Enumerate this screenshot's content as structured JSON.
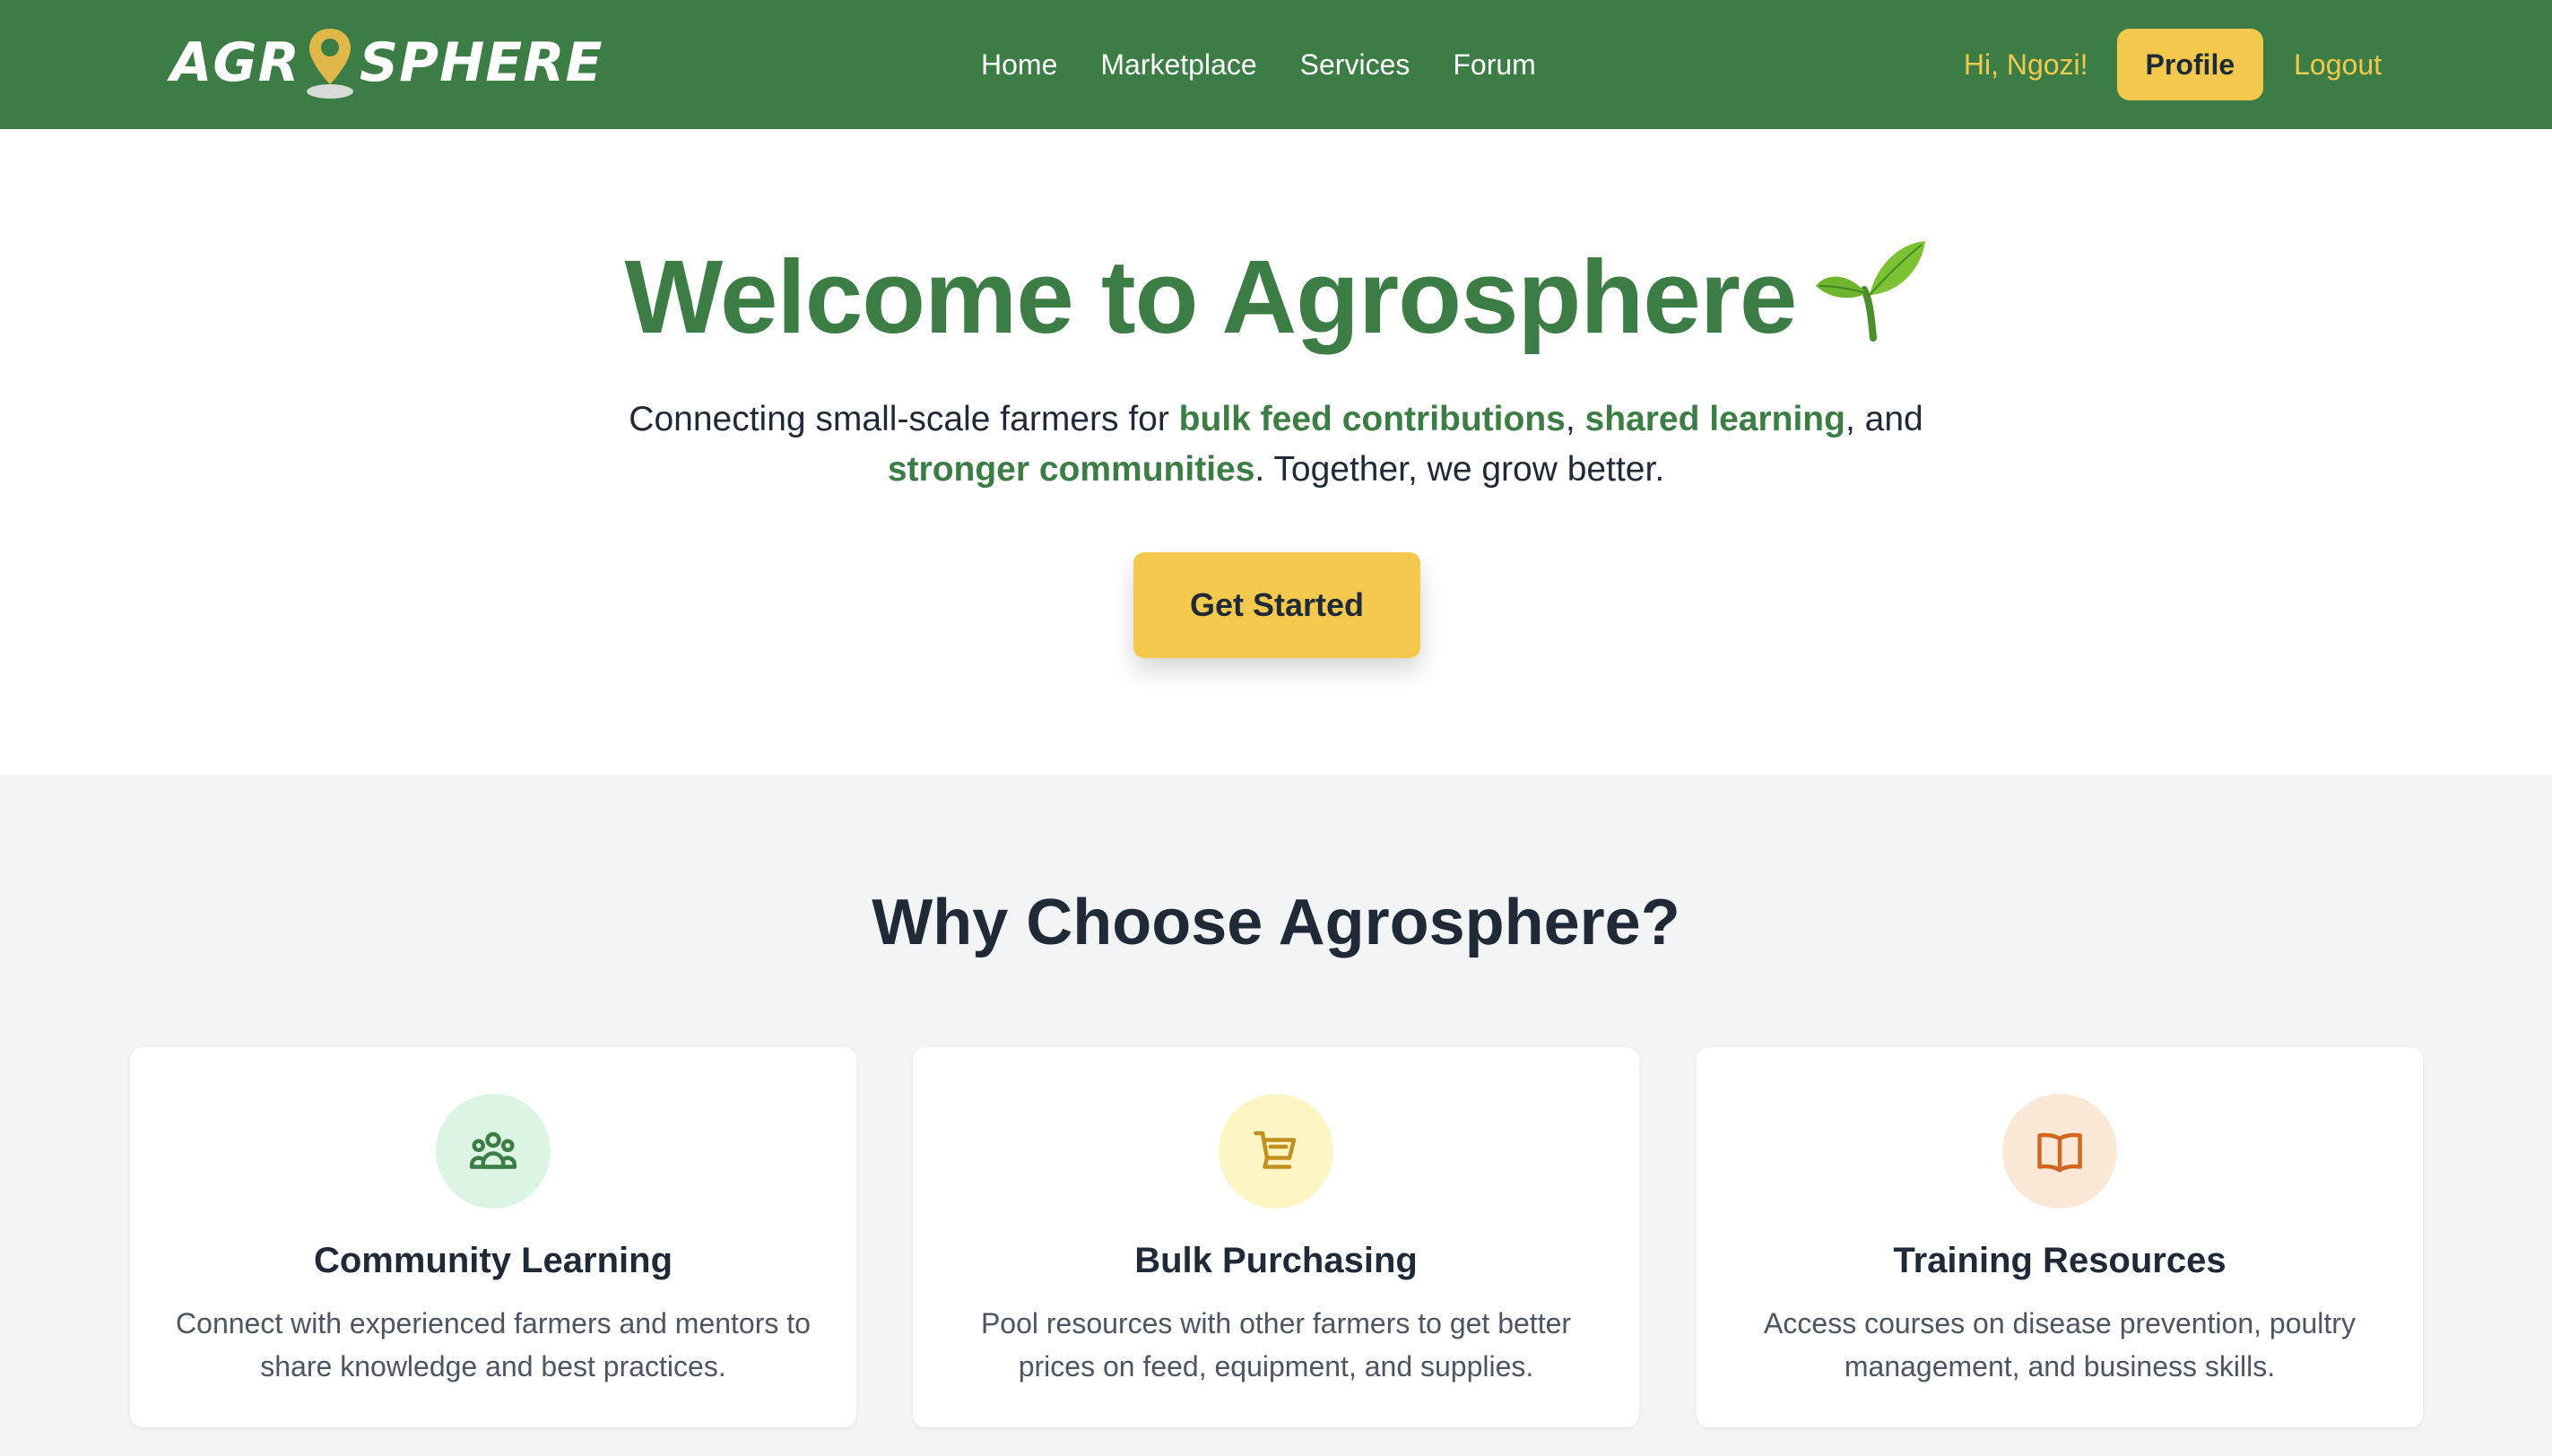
{
  "nav": {
    "logo_left": "AGR",
    "logo_right": "SPHERE",
    "links": [
      "Home",
      "Marketplace",
      "Services",
      "Forum"
    ],
    "greeting": "Hi, Ngozi!",
    "profile_label": "Profile",
    "logout_label": "Logout"
  },
  "hero": {
    "title": "Welcome to Agrosphere",
    "subtitle_part1": "Connecting small-scale farmers for ",
    "highlight1": "bulk feed contributions",
    "subtitle_part2": ", ",
    "highlight2": "shared learning",
    "subtitle_part3": ", and ",
    "highlight3": "stronger communities",
    "subtitle_part4": ". Together, we grow better.",
    "cta_label": "Get Started"
  },
  "features": {
    "title": "Why Choose Agrosphere?",
    "cards": [
      {
        "icon": "users-icon",
        "title": "Community Learning",
        "description": "Connect with experienced farmers and mentors to share knowledge and best practices."
      },
      {
        "icon": "cart-icon",
        "title": "Bulk Purchasing",
        "description": "Pool resources with other farmers to get better prices on feed, equipment, and supplies."
      },
      {
        "icon": "book-icon",
        "title": "Training Resources",
        "description": "Access courses on disease prevention, poultry management, and business skills."
      }
    ]
  },
  "colors": {
    "primary_green": "#3b7d44",
    "accent_yellow": "#f2c94c",
    "section_bg": "#f3f4f6"
  }
}
